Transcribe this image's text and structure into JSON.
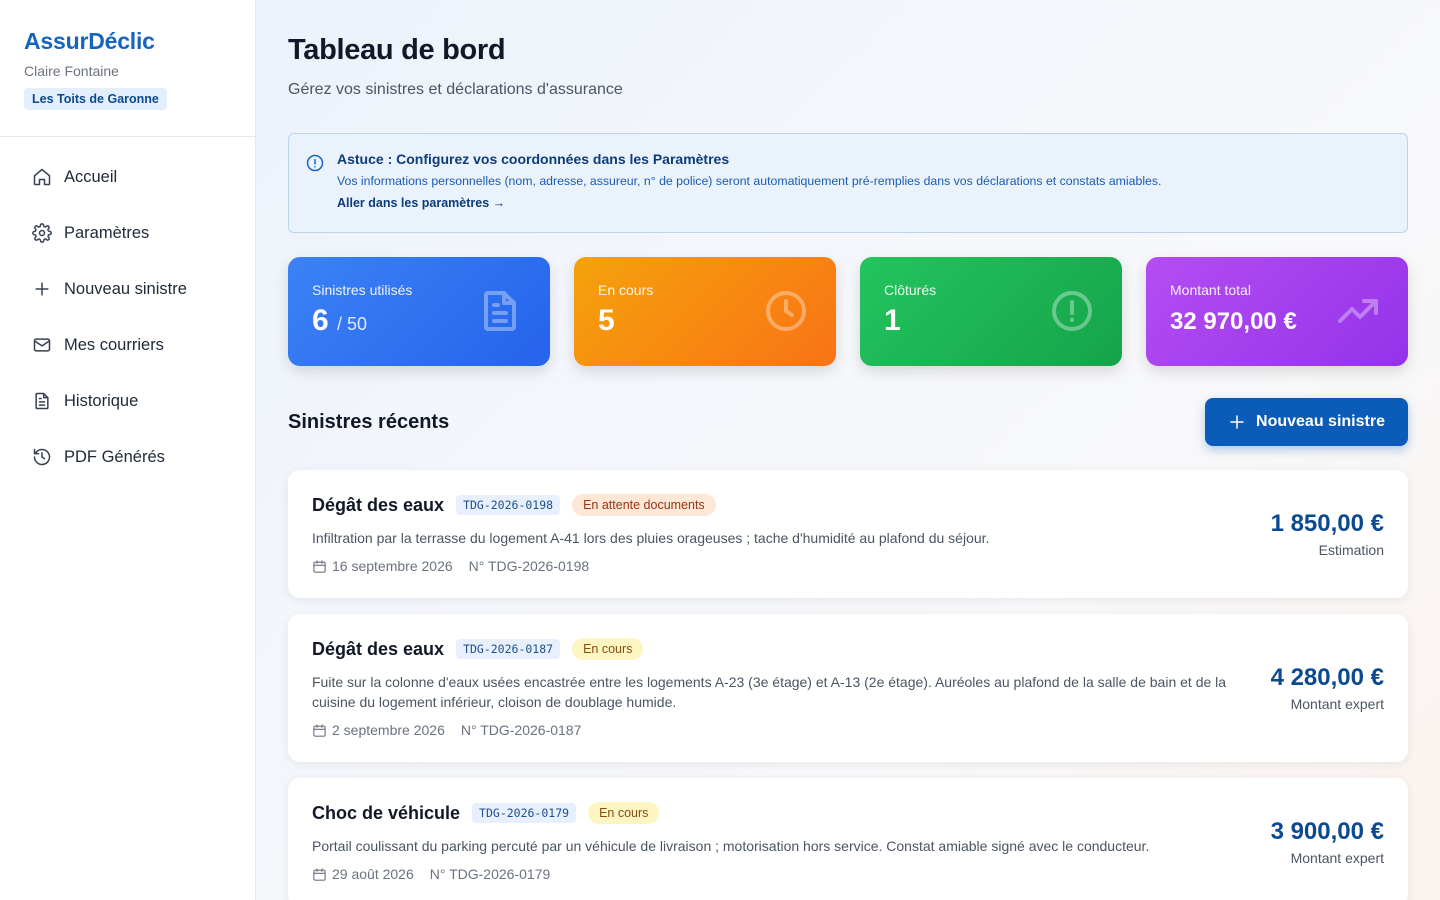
{
  "brand": {
    "name": "AssurDéclic",
    "user": "Claire Fontaine",
    "org": "Les Toits de Garonne"
  },
  "nav": {
    "items": [
      {
        "label": "Accueil",
        "icon": "home-icon"
      },
      {
        "label": "Paramètres",
        "icon": "gear-icon"
      },
      {
        "label": "Nouveau sinistre",
        "icon": "plus-icon"
      },
      {
        "label": "Mes courriers",
        "icon": "mail-icon"
      },
      {
        "label": "Historique",
        "icon": "document-icon"
      },
      {
        "label": "PDF Générés",
        "icon": "history-icon"
      }
    ]
  },
  "page": {
    "title": "Tableau de bord",
    "subtitle": "Gérez vos sinistres et déclarations d'assurance"
  },
  "tip": {
    "title": "Astuce : Configurez vos coordonnées dans les Paramètres",
    "text": "Vos informations personnelles (nom, adresse, assureur, n° de police) seront automatiquement pré-remplies dans vos déclarations et constats amiables.",
    "link": "Aller dans les paramètres →"
  },
  "stats": {
    "used": {
      "label": "Sinistres utilisés",
      "value": "6",
      "max": "/ 50"
    },
    "in_progress": {
      "label": "En cours",
      "value": "5"
    },
    "closed": {
      "label": "Clôturés",
      "value": "1"
    },
    "total": {
      "label": "Montant total",
      "value": "32 970,00 €"
    }
  },
  "recent": {
    "title": "Sinistres récents",
    "new_button": "Nouveau sinistre",
    "claims": [
      {
        "type": "Dégât des eaux",
        "ref": "TDG-2026-0198",
        "status": "En attente documents",
        "description": "Infiltration par la terrasse du logement A-41 lors des pluies orageuses ; tache d'humidité au plafond du séjour.",
        "date": "16 septembre 2026",
        "number": "N° TDG-2026-0198",
        "amount": "1 850,00 €",
        "amount_label": "Estimation"
      },
      {
        "type": "Dégât des eaux",
        "ref": "TDG-2026-0187",
        "status": "En cours",
        "description": "Fuite sur la colonne d'eaux usées encastrée entre les logements A-23 (3e étage) et A-13 (2e étage). Auréoles au plafond de la salle de bain et de la cuisine du logement inférieur, cloison de doublage humide.",
        "date": "2 septembre 2026",
        "number": "N° TDG-2026-0187",
        "amount": "4 280,00 €",
        "amount_label": "Montant expert"
      },
      {
        "type": "Choc de véhicule",
        "ref": "TDG-2026-0179",
        "status": "En cours",
        "description": "Portail coulissant du parking percuté par un véhicule de livraison ; motorisation hors service. Constat amiable signé avec le conducteur.",
        "date": "29 août 2026",
        "number": "N° TDG-2026-0179",
        "amount": "3 900,00 €",
        "amount_label": "Montant expert"
      }
    ]
  }
}
